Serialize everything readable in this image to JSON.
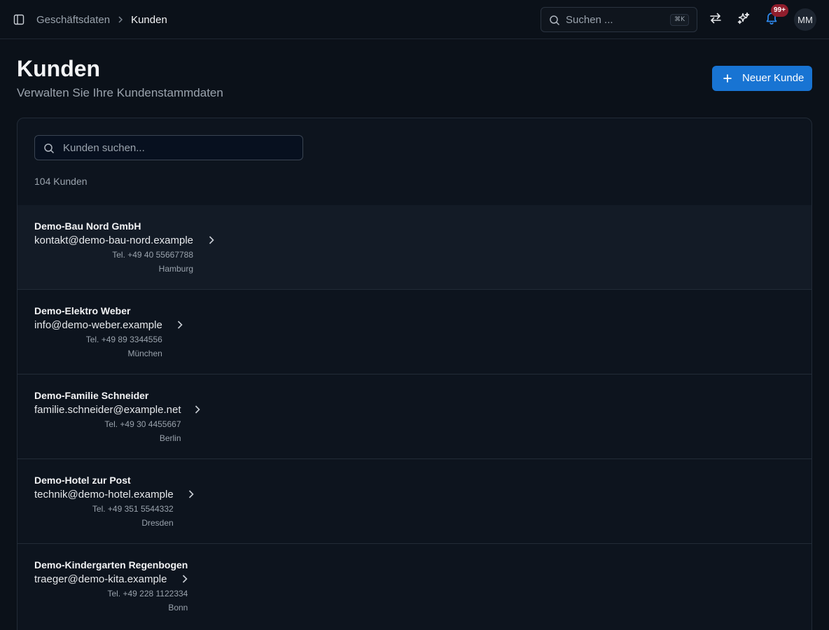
{
  "header": {
    "breadcrumb": {
      "parent": "Geschäftsdaten",
      "current": "Kunden"
    },
    "search": {
      "placeholder": "Suchen ...",
      "shortcut": "⌘K"
    },
    "notifications": {
      "badge": "99+"
    },
    "avatar_initials": "MM"
  },
  "page": {
    "title": "Kunden",
    "subtitle": "Verwalten Sie Ihre Kundenstammdaten",
    "new_button_label": "Neuer Kunde"
  },
  "list": {
    "search_placeholder": "Kunden suchen...",
    "count_label": "104 Kunden",
    "customers": [
      {
        "name": "Demo-Bau Nord GmbH",
        "email": "kontakt@demo-bau-nord.example",
        "phone": "Tel. +49 40 55667788",
        "city": "Hamburg"
      },
      {
        "name": "Demo-Elektro Weber",
        "email": "info@demo-weber.example",
        "phone": "Tel. +49 89 3344556",
        "city": "München"
      },
      {
        "name": "Demo-Familie Schneider",
        "email": "familie.schneider@example.net",
        "phone": "Tel. +49 30 4455667",
        "city": "Berlin"
      },
      {
        "name": "Demo-Hotel zur Post",
        "email": "technik@demo-hotel.example",
        "phone": "Tel. +49 351 5544332",
        "city": "Dresden"
      },
      {
        "name": "Demo-Kindergarten Regenbogen",
        "email": "traeger@demo-kita.example",
        "phone": "Tel. +49 228 1122334",
        "city": "Bonn"
      }
    ]
  },
  "colors": {
    "background": "#0b1119",
    "card": "#0d141e",
    "accent": "#1874d3",
    "notification_icon": "#2f8bf0",
    "badge": "#8f1d2c"
  },
  "icons": {
    "sidebar_toggle": "sidebar-toggle-icon",
    "breadcrumb_separator": "chevron-right-icon",
    "search": "search-icon",
    "switch": "arrows-left-right-icon",
    "ai": "sparkles-icon",
    "notifications": "bell-icon",
    "new": "plus-icon",
    "row": "chevron-right-icon"
  }
}
